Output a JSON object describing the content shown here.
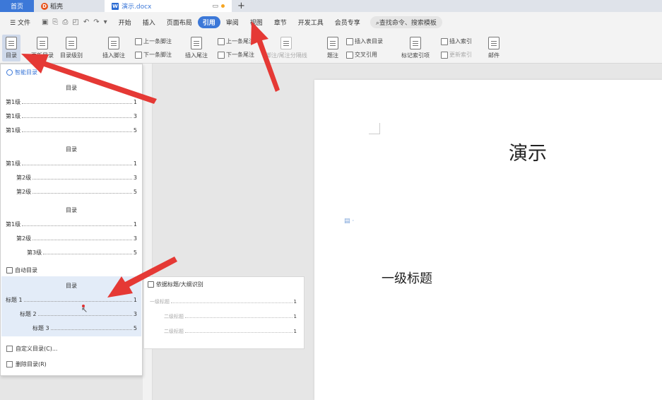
{
  "tabs": {
    "home": "首页",
    "docer": "稻壳",
    "doc": "演示.docx",
    "plus": "+"
  },
  "menu": {
    "file": "文件",
    "items": [
      "开始",
      "插入",
      "页面布局",
      "引用",
      "审阅",
      "视图",
      "章节",
      "开发工具",
      "会员专享"
    ],
    "active_index": 3,
    "search": "查找命令、搜索模板"
  },
  "ribbon": {
    "toc": "目录",
    "update_toc": "更新目录",
    "toc_level": "目录级别",
    "insert_footnote": "插入脚注",
    "prev_footnote": "上一条脚注",
    "next_footnote": "下一条脚注",
    "insert_endnote": "插入尾注",
    "prev_endnote": "上一条尾注",
    "next_endnote": "下一条尾注",
    "footnote_sep": "脚注/尾注分隔线",
    "caption": "题注",
    "insert_table_toc": "插入表目录",
    "cross_ref": "交叉引用",
    "mark_index": "标记索引项",
    "insert_index": "插入索引",
    "update_index": "更新索引",
    "mail": "邮件"
  },
  "dropdown": {
    "smart_toc": "智能目录",
    "toc_title": "目录",
    "block1": [
      {
        "label": "第1级",
        "page": "1"
      },
      {
        "label": "第1级",
        "page": "3"
      },
      {
        "label": "第1级",
        "page": "5"
      }
    ],
    "block2": [
      {
        "label": "第1级",
        "page": "1"
      },
      {
        "label": "第2级",
        "page": "3"
      },
      {
        "label": "第2级",
        "page": "5"
      }
    ],
    "block3": [
      {
        "label": "第1级",
        "page": "1"
      },
      {
        "label": "第2级",
        "page": "3"
      },
      {
        "label": "第3级",
        "page": "5"
      }
    ],
    "auto_toc": "自动目录",
    "block4": [
      {
        "label": "标题 1",
        "page": "1"
      },
      {
        "label": "标题 2",
        "page": "3"
      },
      {
        "label": "标题 3",
        "page": "5"
      }
    ],
    "custom_toc": "自定义目录(C)...",
    "delete_toc": "删除目录(R)"
  },
  "subpanel": {
    "head": "依据标题/大纲识别",
    "lines": [
      {
        "label": "一级标题",
        "page": "1"
      },
      {
        "label": "二级标题",
        "page": "1"
      },
      {
        "label": "二级标题",
        "page": "1"
      }
    ]
  },
  "document": {
    "title": "演示",
    "heading1": "一级标题"
  },
  "colors": {
    "accent": "#3c78d8",
    "arrow": "#e53935"
  }
}
